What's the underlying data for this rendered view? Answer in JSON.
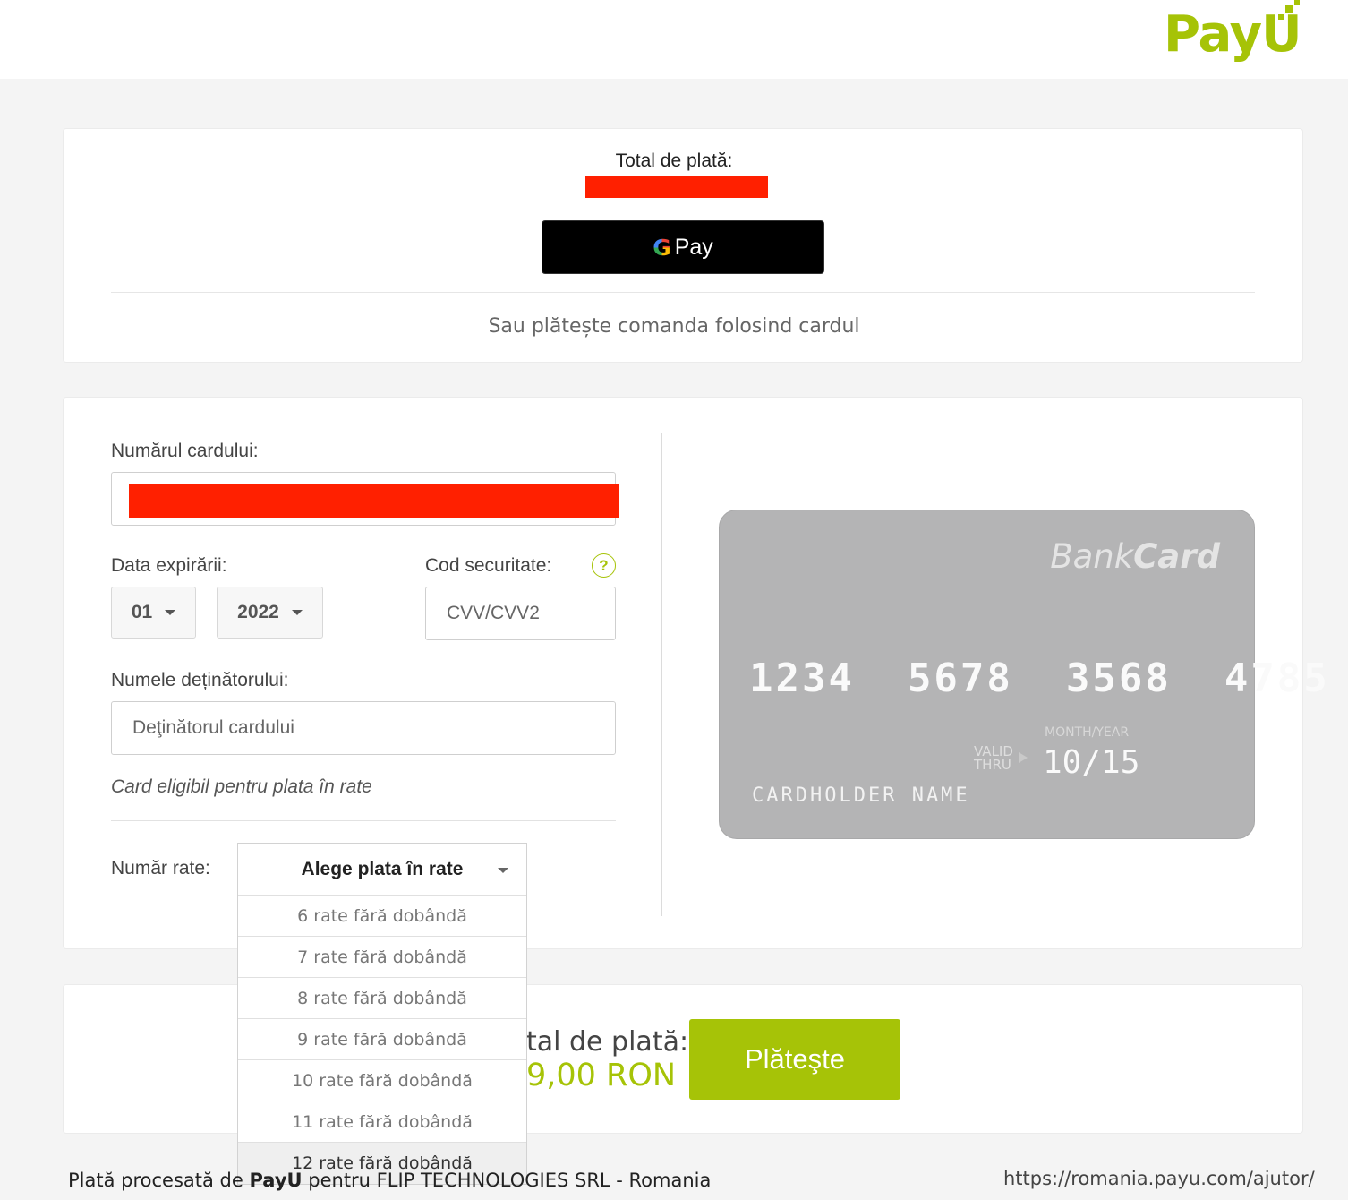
{
  "brand": {
    "logo_text_main": "Pay",
    "logo_text_accent": "U"
  },
  "summary": {
    "total_label": "Total de plată:",
    "gpay_g": "G",
    "gpay_label": "Pay",
    "or_card": "Sau plătește comanda folosind cardul"
  },
  "form": {
    "card_number_label": "Numărul cardului:",
    "expiry_label": "Data expirării:",
    "expiry_month": "01",
    "expiry_year": "2022",
    "cvv_label": "Cod securitate:",
    "cvv_help": "?",
    "cvv_placeholder": "CVV/CVV2",
    "holder_label": "Numele deținătorului:",
    "holder_placeholder": "Deţinătorul cardului",
    "eligible_text": "Card eligibil pentru plata în rate",
    "installments_label": "Număr rate:",
    "installments_selected": "Alege plata în rate",
    "installments_options": [
      "6 rate fără dobândă",
      "7 rate fără dobândă",
      "8 rate fără dobândă",
      "9 rate fără dobândă",
      "10 rate fără dobândă",
      "11 rate fără dobândă",
      "12 rate fără dobândă"
    ]
  },
  "card_preview": {
    "brand_light": "Bank",
    "brand_bold": "Card",
    "number": "1234  5678  3568  4785",
    "valid_thru": "VALID\nTHRU",
    "month_year_label": "MONTH/YEAR",
    "expiry": "10/15",
    "holder": "CARDHOLDER NAME"
  },
  "checkout": {
    "total_label_visible": "tal de plată:",
    "total_value_visible": "9,00 RON",
    "pay_button": "Plăteşte"
  },
  "footer": {
    "processed_prefix": "Plată procesată de ",
    "processed_brand": "PayU",
    "processed_suffix": " pentru FLIP TECHNOLOGIES SRL - Romania",
    "help_link": "https://romania.payu.com/ajutor/"
  },
  "colors": {
    "accent": "#a6c307",
    "redaction": "#ff2000"
  }
}
